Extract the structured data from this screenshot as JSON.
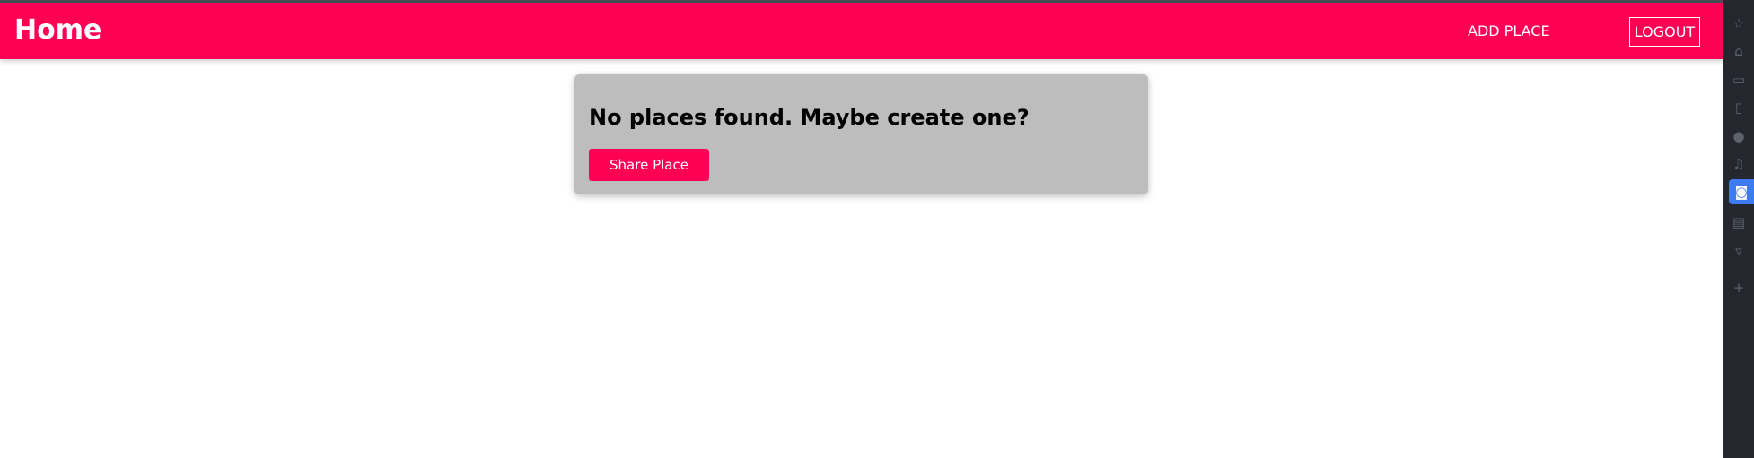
{
  "header": {
    "title": "Home",
    "nav": {
      "add_place": "ADD PLACE",
      "logout": "LOGOUT"
    },
    "background": "#ff0055"
  },
  "main": {
    "card": {
      "message": "No places found. Maybe create one?",
      "button_label": "Share Place"
    }
  },
  "sidebar": {
    "icons": [
      {
        "name": "star-icon",
        "glyph": "☆"
      },
      {
        "name": "home-icon",
        "glyph": "⌂"
      },
      {
        "name": "message-icon",
        "glyph": "▭"
      },
      {
        "name": "documents-icon",
        "glyph": "▯"
      },
      {
        "name": "download-icon",
        "glyph": "●"
      },
      {
        "name": "music-icon",
        "glyph": "♫"
      },
      {
        "name": "camera-icon",
        "glyph": "◙",
        "active": true
      },
      {
        "name": "film-icon",
        "glyph": "▤"
      },
      {
        "name": "trash-icon",
        "glyph": "▿"
      },
      {
        "name": "add-icon",
        "glyph": "+"
      }
    ],
    "active_color": "#3e7bf2"
  }
}
